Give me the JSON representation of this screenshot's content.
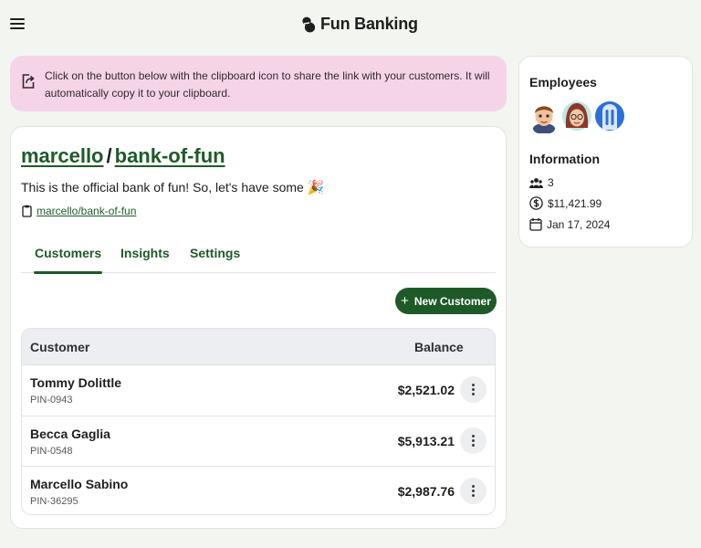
{
  "app": {
    "brand": "Fun Banking"
  },
  "notice": {
    "text": "Click on the button below with the clipboard icon to share the link with your customers. It will automatically copy it to your clipboard."
  },
  "bank": {
    "owner": "marcello",
    "separator": "/",
    "name": "bank-of-fun",
    "description": "This is the official bank of fun! So, let's have some",
    "emoji": "🎉",
    "link_text": "marcello/bank-of-fun"
  },
  "tabs": [
    {
      "label": "Customers",
      "active": true
    },
    {
      "label": "Insights",
      "active": false
    },
    {
      "label": "Settings",
      "active": false
    }
  ],
  "new_customer_label": "New Customer",
  "table": {
    "headers": {
      "customer": "Customer",
      "balance": "Balance"
    },
    "rows": [
      {
        "name": "Tommy Dolittle",
        "pin": "PIN-0943",
        "balance": "$2,521.02"
      },
      {
        "name": "Becca Gaglia",
        "pin": "PIN-0548",
        "balance": "$5,913.21"
      },
      {
        "name": "Marcello Sabino",
        "pin": "PIN-36295",
        "balance": "$2,987.76"
      }
    ]
  },
  "sidebar": {
    "employees_heading": "Employees",
    "information_heading": "Information",
    "employee_count": "3",
    "total_balance": "$11,421.99",
    "date": "Jan 17, 2024"
  },
  "colors": {
    "brand_green": "#1e5a28",
    "notice_pink": "#f5d4e8",
    "page_bg": "#f3f5f1"
  },
  "icons": [
    "menu-icon",
    "logo-icon",
    "share-icon",
    "clipboard-icon",
    "plus-icon",
    "kebab-icon",
    "users-icon",
    "dollar-icon",
    "calendar-icon"
  ]
}
